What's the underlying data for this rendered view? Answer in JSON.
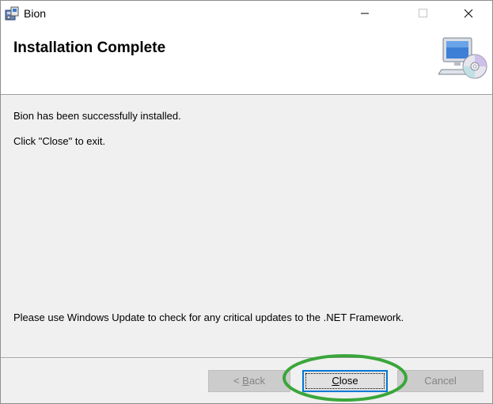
{
  "window": {
    "title": "Bion"
  },
  "header": {
    "title": "Installation Complete",
    "graphic": "computer-cd-icon"
  },
  "body": {
    "line1": "Bion has been successfully installed.",
    "line2": "Click \"Close\" to exit.",
    "line3": "Please use Windows Update to check for any critical updates to the .NET Framework."
  },
  "buttons": {
    "back": {
      "prefix": "< ",
      "mnemonic": "B",
      "rest": "ack",
      "enabled": false
    },
    "close": {
      "mnemonic": "C",
      "rest": "lose",
      "enabled": true,
      "focused": true
    },
    "cancel": {
      "label": "Cancel",
      "enabled": false
    }
  },
  "icons": {
    "app": "installer-package-icon",
    "minimize": "minimize-icon",
    "maximize": "maximize-icon",
    "close": "close-icon"
  },
  "colors": {
    "focus_border": "#0078d7",
    "annotation_ring": "#3aa63a",
    "dialog_background": "#f0f0f0"
  }
}
